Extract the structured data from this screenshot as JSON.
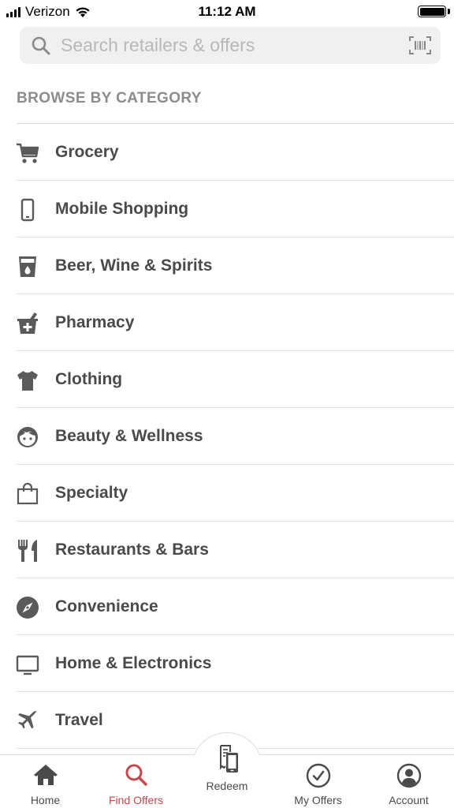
{
  "status_bar": {
    "carrier": "Verizon",
    "time": "11:12 AM"
  },
  "search": {
    "placeholder": "Search retailers & offers",
    "icon": "search-icon",
    "scan_icon": "barcode-scan-icon"
  },
  "section_header": "BROWSE BY CATEGORY",
  "categories": [
    {
      "label": "Grocery",
      "icon": "shopping-cart-icon"
    },
    {
      "label": "Mobile Shopping",
      "icon": "mobile-phone-icon"
    },
    {
      "label": "Beer, Wine & Spirits",
      "icon": "drink-glass-icon"
    },
    {
      "label": "Pharmacy",
      "icon": "mortar-pestle-icon"
    },
    {
      "label": "Clothing",
      "icon": "tshirt-icon"
    },
    {
      "label": "Beauty & Wellness",
      "icon": "face-icon"
    },
    {
      "label": "Specialty",
      "icon": "shopping-bag-icon"
    },
    {
      "label": "Restaurants & Bars",
      "icon": "fork-knife-icon"
    },
    {
      "label": "Convenience",
      "icon": "compass-icon"
    },
    {
      "label": "Home & Electronics",
      "icon": "monitor-icon"
    },
    {
      "label": "Travel",
      "icon": "airplane-icon"
    }
  ],
  "bottom_nav": {
    "home": "Home",
    "find_offers": "Find Offers",
    "redeem": "Redeem",
    "my_offers": "My Offers",
    "account": "Account",
    "active": "find_offers",
    "active_color": "#c8474b",
    "icon_color": "#4a4a4a"
  }
}
